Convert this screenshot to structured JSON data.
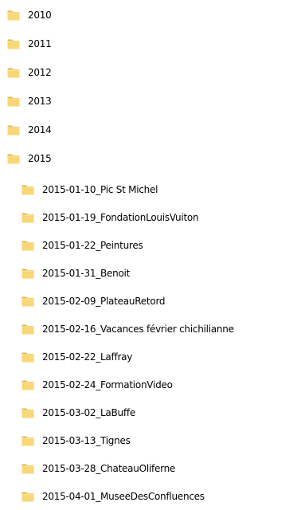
{
  "folder_tree": {
    "icon_name": "folder-icon",
    "folder_color": "#f8d776",
    "folder_tab_color": "#e6b94d",
    "years": [
      {
        "label": "2010"
      },
      {
        "label": "2011"
      },
      {
        "label": "2012"
      },
      {
        "label": "2013"
      },
      {
        "label": "2014"
      },
      {
        "label": "2015"
      }
    ],
    "subfolders_2015": [
      {
        "label": "2015-01-10_Pic St Michel"
      },
      {
        "label": "2015-01-19_FondationLouisVuiton"
      },
      {
        "label": "2015-01-22_Peintures"
      },
      {
        "label": "2015-01-31_Benoit"
      },
      {
        "label": "2015-02-09_PlateauRetord"
      },
      {
        "label": "2015-02-16_Vacances février chichilianne"
      },
      {
        "label": "2015-02-22_Laffray"
      },
      {
        "label": "2015-02-24_FormationVideo"
      },
      {
        "label": "2015-03-02_LaBuffe"
      },
      {
        "label": "2015-03-13_Tignes"
      },
      {
        "label": "2015-03-28_ChateauOliferne"
      },
      {
        "label": "2015-04-01_MuseeDesConfluences"
      }
    ]
  }
}
